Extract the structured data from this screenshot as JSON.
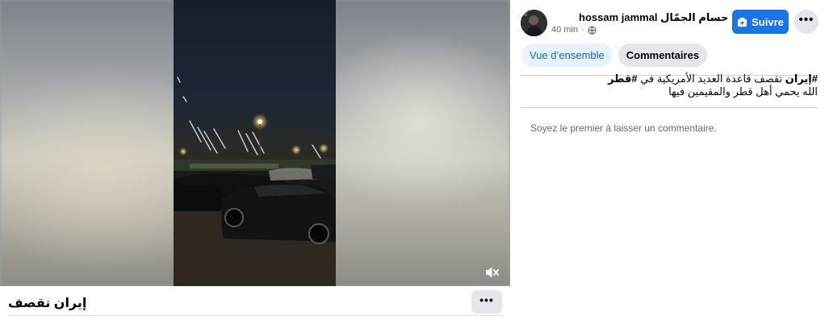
{
  "video": {
    "title": "إيران تقصف",
    "more_label": "•••",
    "mute_icon": "speaker-muted-icon"
  },
  "post": {
    "author_name": "hossam jammal حسام الجمّال",
    "time": "40 min",
    "separator": "·",
    "audience_icon": "globe-icon",
    "follow_label": "Suivre",
    "more_label": "•••",
    "text_hashtag_1": "#إيران",
    "text_line_1": " تقصف قاعدة العديد الأمريكية في ",
    "text_hashtag_2": "#قطر",
    "text_line_2": "الله يحمي أهل قطر والمقيمين فيها"
  },
  "tabs": [
    {
      "label": "Vue d’ensemble"
    },
    {
      "label": "Commentaires"
    }
  ],
  "comments": {
    "empty_message": "Soyez le premier à laisser un commentaire."
  },
  "colors": {
    "accent": "#1b74e4",
    "tab_active_bg": "#e7f3ff",
    "tab_active_text": "#1464cc",
    "button_grey": "#e4e6eb",
    "secondary_text": "#65676b"
  }
}
